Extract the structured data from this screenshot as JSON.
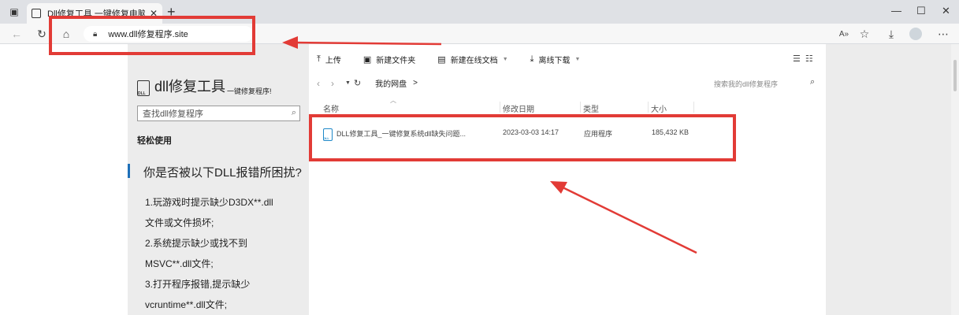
{
  "browser": {
    "tab_title": "Dll修复工具 一键修复电脑丢失D...",
    "tab_close": "✕",
    "new_tab": "+",
    "address": "www.dll修复程序.site",
    "window_controls": {
      "minimize": "—",
      "maximize": "☐",
      "close": "✕"
    }
  },
  "sidebar": {
    "logo_title": "dll修复工具",
    "logo_subtitle": "一键修复程序!",
    "search_placeholder": "查找dll修复程序",
    "section_heading": "轻松使用",
    "question": "你是否被以下DLL报错所困扰?",
    "lines": [
      "1.玩游戏时提示缺少D3DX**.dll",
      "文件或文件损坏;",
      "2.系统提示缺少或找不到",
      "MSVC**.dll文件;",
      "3.打开程序报错,提示缺少",
      "vcruntime**.dll文件;"
    ]
  },
  "filemanager": {
    "toolbar": {
      "upload": "上传",
      "new_folder": "新建文件夹",
      "new_doc": "新建在线文档",
      "offline_download": "离线下载"
    },
    "breadcrumb": "我的网盘",
    "breadcrumb_sep": ">",
    "search_placeholder": "搜索我的dll修复程序",
    "columns": {
      "name": "名称",
      "modified": "修改日期",
      "type": "类型",
      "size": "大小"
    },
    "files": [
      {
        "name": "DLL修复工具_一键修复系统dll缺失问题...",
        "modified": "2023-03-03 14:17",
        "type": "应用程序",
        "size": "185,432 KB"
      }
    ]
  },
  "colors": {
    "highlight": "#e23b36",
    "accent": "#1e6fb8"
  }
}
